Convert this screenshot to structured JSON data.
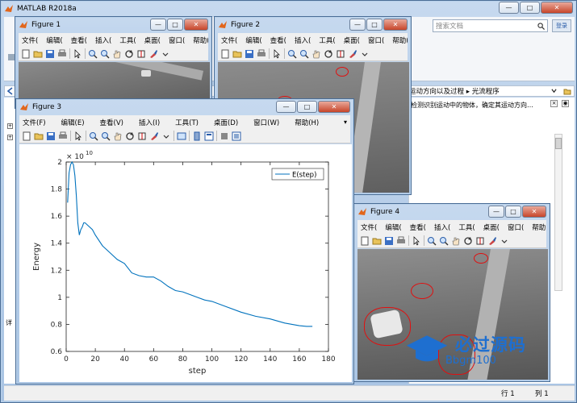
{
  "matlab": {
    "title": "MATLAB R2018a",
    "search_placeholder": "搜索文档",
    "breadcrumb_tail": "运动方向以及过程",
    "breadcrumb_sep": "▸",
    "breadcrumb_last": "光流程序",
    "desc_text": "检测识别运动中的物体，确定其运动方向…",
    "status_row": "行",
    "status_row_val": "1",
    "status_col": "列",
    "status_col_val": "1",
    "detail_label": "详"
  },
  "fig1": {
    "title": "Figure 1",
    "menu": [
      "文件(",
      "编辑(",
      "查看(",
      "插入(",
      "工具(",
      "桌面(",
      "窗口(",
      "帮助("
    ]
  },
  "fig2": {
    "title": "Figure 2",
    "menu": [
      "文件(",
      "编辑(",
      "查看(",
      "插入(",
      "工具(",
      "桌面(",
      "窗口(",
      "帮助("
    ]
  },
  "fig3": {
    "title": "Figure 3",
    "menu": [
      "文件(F)",
      "编辑(E)",
      "查看(V)",
      "插入(I)",
      "工具(T)",
      "桌面(D)",
      "窗口(W)",
      "帮助(H)"
    ]
  },
  "fig4": {
    "title": "Figure 4",
    "menu": [
      "文件(",
      "编辑(",
      "查看(",
      "插入(",
      "工具(",
      "桌面(",
      "窗口(",
      "帮助("
    ]
  },
  "watermark": {
    "brand": "必过源码",
    "url": "Bbgm100"
  },
  "chart_data": {
    "type": "line",
    "xlabel": "step",
    "ylabel": "Energy",
    "exponent_label": "× 10",
    "exponent_power": "10",
    "xlim": [
      0,
      180
    ],
    "ylim": [
      0.6,
      2.0
    ],
    "xticks": [
      0,
      20,
      40,
      60,
      80,
      100,
      120,
      140,
      160,
      180
    ],
    "yticks": [
      0.6,
      0.8,
      1,
      1.2,
      1.4,
      1.6,
      1.8,
      2
    ],
    "ytick_labels": [
      "0.6",
      "0.8",
      "1",
      "1.2",
      "1.4",
      "1.6",
      "1.8",
      "2"
    ],
    "legend": "top-right",
    "series": [
      {
        "name": "E(step)",
        "color": "#0072bd",
        "x": [
          1,
          2,
          3,
          4,
          5,
          6,
          7,
          8,
          9,
          10,
          11,
          12,
          13,
          15,
          18,
          20,
          25,
          30,
          35,
          40,
          45,
          50,
          55,
          60,
          65,
          70,
          75,
          80,
          85,
          90,
          95,
          100,
          110,
          120,
          130,
          140,
          150,
          160,
          165,
          169
        ],
        "y": [
          1.7,
          1.92,
          1.98,
          2.0,
          1.98,
          1.9,
          1.75,
          1.55,
          1.46,
          1.5,
          1.52,
          1.55,
          1.55,
          1.53,
          1.5,
          1.46,
          1.38,
          1.33,
          1.28,
          1.25,
          1.18,
          1.16,
          1.15,
          1.15,
          1.12,
          1.08,
          1.05,
          1.04,
          1.02,
          1.0,
          0.98,
          0.97,
          0.93,
          0.89,
          0.86,
          0.84,
          0.81,
          0.79,
          0.785,
          0.785
        ]
      }
    ]
  }
}
